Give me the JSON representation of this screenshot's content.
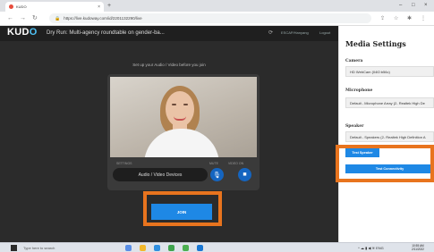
{
  "browser": {
    "tab_title": "KUDO",
    "url": "https://live.kudoway.com/id/2201132290/live",
    "window_min": "–",
    "window_max": "□",
    "window_close": "×"
  },
  "header": {
    "logo_left": "KUD",
    "logo_o": "O",
    "meeting_title": "Dry Run: Multi-agency roundtable on gender-ba...",
    "link1": "ESCAP/Hanyang",
    "link2": "Logout"
  },
  "stage": {
    "setup_text": "Set up your Audio / Video before you join",
    "label_settings": "SETTINGS",
    "label_mute": "MUTE",
    "label_video": "VIDEO ON",
    "devices_label": "Audio / Video Devices",
    "join_label": "JOIN"
  },
  "panel": {
    "title": "Media Settings",
    "camera_label": "Camera",
    "camera_value": "HD WebCam (04f2:b56c)",
    "mic_label": "Microphone",
    "mic_value": "Default - Microphone Array (2- Realtek High De",
    "speaker_label": "Speaker",
    "speaker_value": "Default - Speakers (2- Realtek High Definition A",
    "test_speaker": "Test Speaker",
    "test_connectivity": "Test Connectivity"
  },
  "taskbar": {
    "search_placeholder": "Type here to search",
    "time": "10:55 AM",
    "date": "2/11/2022"
  },
  "colors": {
    "accent": "#1e88e5",
    "highlight": "#e8741e",
    "stage_bg": "#2b2b2b"
  }
}
